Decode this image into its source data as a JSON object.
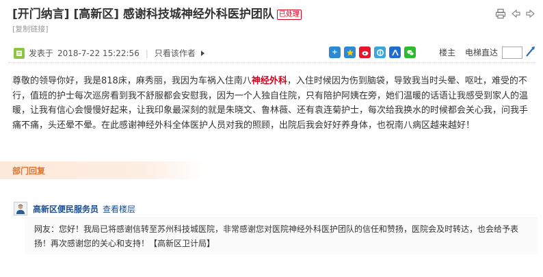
{
  "post": {
    "title": "[开门纳言] [高新区] 感谢科技城神经外科医护团队",
    "status_badge": "已处理",
    "copy_link": "[复制链接]",
    "posted_label": "发表于",
    "posted_time": "2018-7-22 15:22:56",
    "author_only": "只看该作者",
    "floor_label": "楼主",
    "elevator_label": "电梯直达",
    "body_before": "尊敬的领导你好，我是818床，麻秀丽，我因为车祸入住南八",
    "body_highlight": "神经外科",
    "body_after": "，入住时候因为伤到脑袋，导致我当时头晕、呕吐，难受的不行，值班的护士每次巡房看到我不舒服都会安慰我，因为一个人独自住院，只有陪护阿姨在旁，她们温暖的话语让我感受到家人的温暖，让我有信心会慢慢好起来，让我印象最深刻的就是朱晓文、鲁林薇、还有袁连菊护士，每次给我换水的时候都会关心我，问我手痛不痛，头还晕不晕。在此感谢神经外科全体医护人员对我的照顾，出院后我会好好养身体，也祝南八病区越来越好！"
  },
  "dept_reply": {
    "section_label": "部门回复",
    "name": "高新区便民服务员",
    "view_floor": "查看楼层",
    "text": "网友：您好！我局已将感谢信转至苏州科技城医院，非常感谢您对医院神经外科医护团队的信任和赞扬，医院会及时转达，也会给予表扬！再次感谢您的关心和支持！【高新区卫计局】"
  },
  "icons": {
    "header": [
      "print-icon",
      "prev-arrow-icon",
      "next-arrow-icon"
    ],
    "share": [
      "share-plus-icon",
      "star-icon",
      "weibo-icon",
      "qzone-icon",
      "renren-icon",
      "wechat-icon"
    ]
  },
  "colors": {
    "highlight": "#d9001b",
    "link": "#1a4d8f",
    "dept_label": "#e0722b"
  }
}
